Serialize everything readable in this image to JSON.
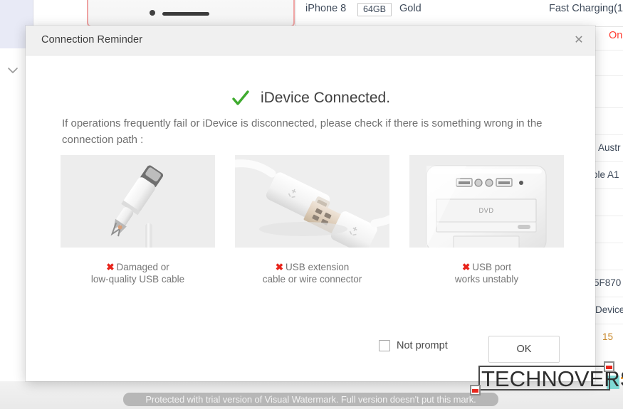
{
  "background": {
    "device": {
      "model": "iPhone 8",
      "capacity": "64GB",
      "color": "Gold",
      "charging_status": "Fast Charging(1"
    },
    "status_label": "On",
    "table_cells": [
      {
        "text": "Austr"
      },
      {
        "text": "ole A1"
      },
      {
        "text": "5F870"
      },
      {
        "text": "Device"
      }
    ],
    "table_number": "15"
  },
  "dialog": {
    "title": "Connection Reminder",
    "close_label": "✕",
    "headline": "iDevice Connected.",
    "paragraph": "If operations frequently fail or iDevice is disconnected, please check if there is something wrong in the connection path :",
    "cards": [
      {
        "image": "damaged-lightning-cable-photo",
        "xmark": "✖",
        "caption_line1": "Damaged or",
        "caption_line2": "low-quality USB cable"
      },
      {
        "image": "usb-extension-cable-photo",
        "xmark": "✖",
        "caption_line1": "USB extension",
        "caption_line2": "cable or wire connector"
      },
      {
        "image": "pc-tower-usb-port-photo",
        "xmark": "✖",
        "caption_line1": "USB port",
        "caption_line2": "works unstably"
      }
    ],
    "not_prompt_label": "Not prompt",
    "not_prompt_checked": false,
    "ok_label": "OK"
  },
  "watermarks": {
    "trial_notice": "Protected with trial version of Visual Watermark. Full version doesn't put this mark.",
    "brand": "TECHNOVERSE"
  },
  "colors": {
    "accent_red": "#ff3b30",
    "xmark_red": "#e8231a",
    "check_green": "#3fab2f",
    "title_bar": "#f0f0f0",
    "thumb_bg": "#ededed"
  }
}
